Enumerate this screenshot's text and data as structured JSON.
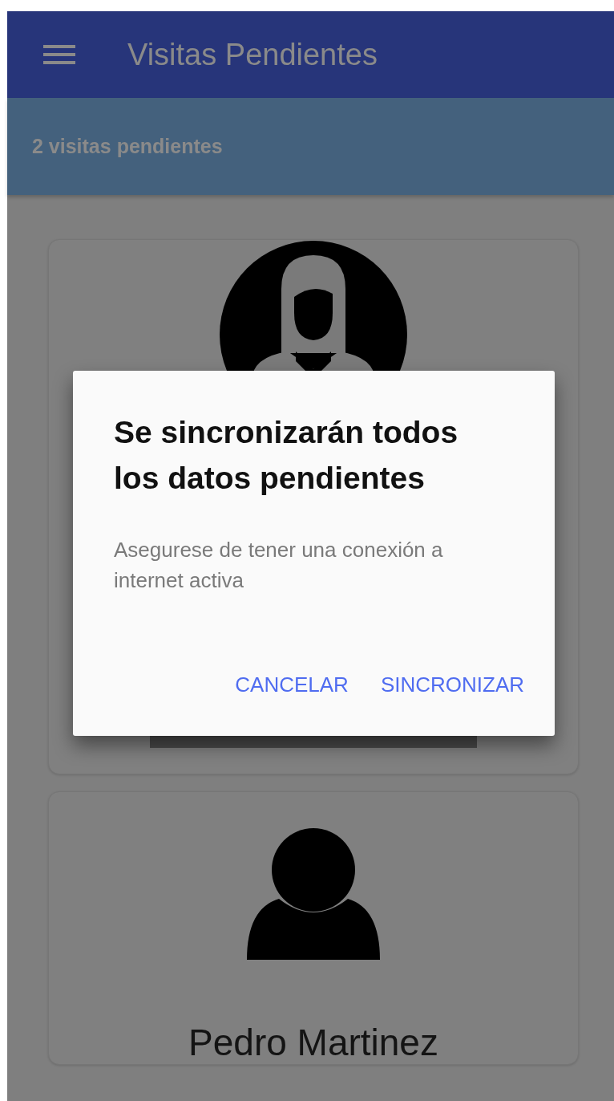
{
  "app_bar": {
    "title": "Visitas Pendientes"
  },
  "summary": "2 visitas pendientes",
  "visits": [
    {
      "kind": "woman"
    },
    {
      "kind": "person",
      "name": "Pedro Martinez"
    }
  ],
  "dialog": {
    "title": "Se sincronizarán todos los datos pendientes",
    "message": "Asegurese de tener una conexión a internet activa",
    "buttons": [
      "CANCELAR",
      "SINCRONIZAR"
    ]
  }
}
